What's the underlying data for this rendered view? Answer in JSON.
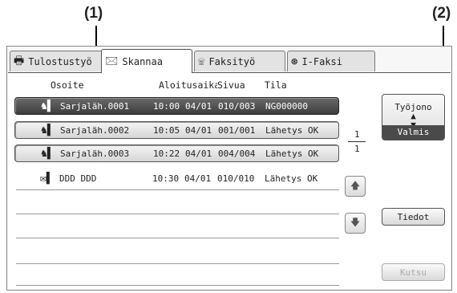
{
  "callouts": {
    "one": "(1)",
    "two": "(2)"
  },
  "tabs": [
    {
      "label": "Tulostustyö",
      "icon": "printer-icon",
      "glyph": "🖶"
    },
    {
      "label": "Skannaa",
      "icon": "scan-icon",
      "glyph": "🖂"
    },
    {
      "label": "Faksityö",
      "icon": "fax-icon",
      "glyph": "☏"
    },
    {
      "label": "I-Faksi",
      "icon": "internet-fax-icon",
      "glyph": "⊛"
    }
  ],
  "columns": {
    "address": "Osoite",
    "start_time": "Aloitusaika",
    "pages": "Sivua",
    "status": "Tila"
  },
  "jobs": [
    {
      "address": "Sarjaläh.0001",
      "time": "10:00",
      "date": "04/01",
      "pages": "010/003",
      "status": "NG000000",
      "icon": "multi-address-icon",
      "glyph": "♞▌"
    },
    {
      "address": "Sarjaläh.0002",
      "time": "10:05",
      "date": "04/01",
      "pages": "001/001",
      "status": "Lähetys OK",
      "icon": "multi-address-icon",
      "glyph": "♞▌"
    },
    {
      "address": "Sarjaläh.0003",
      "time": "10:22",
      "date": "04/01",
      "pages": "004/004",
      "status": "Lähetys OK",
      "icon": "multi-address-icon",
      "glyph": "♞▌"
    },
    {
      "address": "DDD DDD",
      "time": "10:30",
      "date": "04/01",
      "pages": "010/010",
      "status": "Lähetys OK",
      "icon": "email-icon",
      "glyph": "✉▌"
    }
  ],
  "queue_button": {
    "label": "Työjono",
    "arrows": "▲\n▼",
    "mode": "Valmis"
  },
  "pagination": {
    "current": "1",
    "total": "1"
  },
  "scroll": {
    "up": "🡅",
    "down": "🡇"
  },
  "details_button": "Tiedot",
  "call_button": "Kutsu"
}
